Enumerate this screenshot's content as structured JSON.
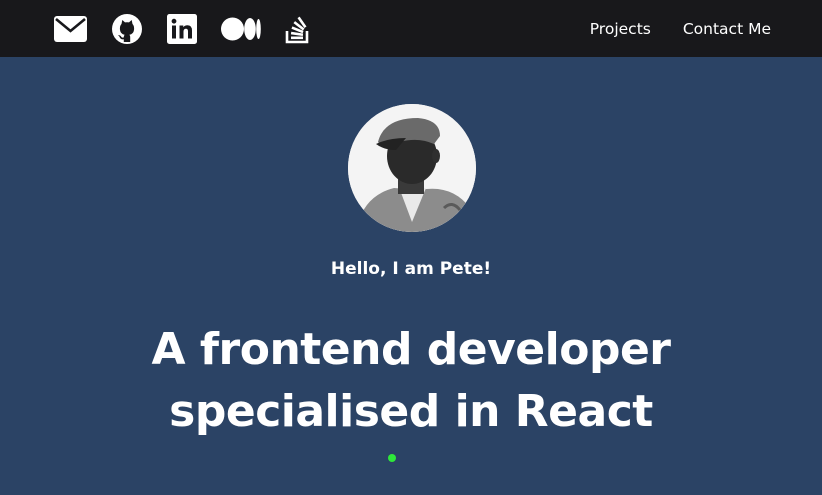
{
  "header": {
    "socials": [
      {
        "icon": "envelope-icon"
      },
      {
        "icon": "github-icon"
      },
      {
        "icon": "linkedin-icon"
      },
      {
        "icon": "medium-icon"
      },
      {
        "icon": "stack-overflow-icon"
      }
    ],
    "nav": {
      "projects": "Projects",
      "contact": "Contact Me"
    }
  },
  "hero": {
    "avatar_icon": "profile-photo",
    "greeting": "Hello, I am Pete!",
    "headline_line1": "A frontend developer",
    "headline_line2": "specialised in React"
  },
  "colors": {
    "header_bg": "#18181b",
    "hero_bg": "#2b4365",
    "accent_dot": "#2ee83a"
  }
}
